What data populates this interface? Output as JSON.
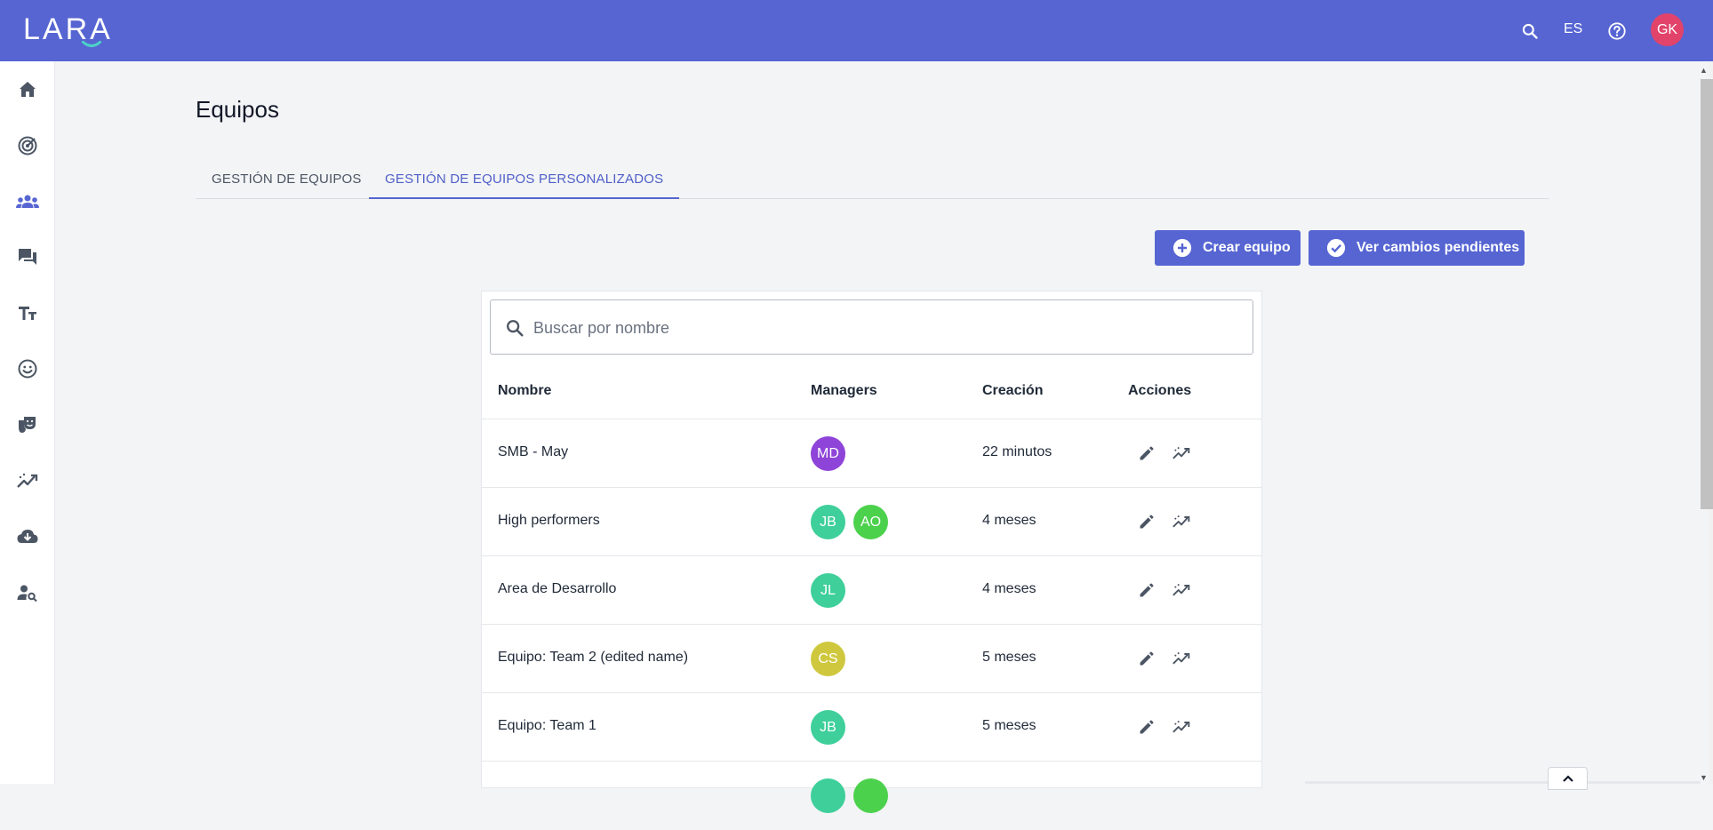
{
  "header": {
    "logo": "LARA",
    "language": "ES",
    "user_initials": "GK",
    "icons": [
      "search-icon",
      "help-icon"
    ],
    "colors": {
      "bar": "#5665d2",
      "avatar": "#e2436a"
    }
  },
  "sidebar": {
    "items": [
      {
        "name": "home",
        "icon": "home-icon"
      },
      {
        "name": "target",
        "icon": "radar-icon"
      },
      {
        "name": "teams",
        "icon": "group-icon",
        "active": true
      },
      {
        "name": "chat",
        "icon": "chat-icon"
      },
      {
        "name": "text",
        "icon": "text-size-icon"
      },
      {
        "name": "mood",
        "icon": "smiley-icon"
      },
      {
        "name": "theater",
        "icon": "masks-icon"
      },
      {
        "name": "analytics",
        "icon": "trend-icon"
      },
      {
        "name": "download",
        "icon": "cloud-download-icon"
      },
      {
        "name": "user-search",
        "icon": "user-search-icon"
      }
    ]
  },
  "page": {
    "title": "Equipos",
    "tabs": [
      {
        "label": "GESTIÓN DE EQUIPOS",
        "active": false
      },
      {
        "label": "GESTIÓN DE EQUIPOS PERSONALIZADOS",
        "active": true
      }
    ],
    "buttons": {
      "create": "Crear equipo",
      "pending": "Ver cambios pendientes"
    }
  },
  "search": {
    "placeholder": "Buscar por nombre",
    "value": ""
  },
  "table": {
    "columns": [
      "Nombre",
      "Managers",
      "Creación",
      "Acciones"
    ],
    "rows": [
      {
        "name": "SMB - May",
        "managers": [
          {
            "initials": "MD",
            "color": "#8e44d8"
          }
        ],
        "created": "22 minutos"
      },
      {
        "name": "High performers",
        "managers": [
          {
            "initials": "JB",
            "color": "#3ecf9a"
          },
          {
            "initials": "AO",
            "color": "#4cd14c"
          }
        ],
        "created": "4 meses"
      },
      {
        "name": "Area de Desarrollo",
        "managers": [
          {
            "initials": "JL",
            "color": "#3ecf9a"
          }
        ],
        "created": "4 meses"
      },
      {
        "name": "Equipo: Team 2 (edited name)",
        "managers": [
          {
            "initials": "CS",
            "color": "#cfc83e"
          }
        ],
        "created": "5 meses"
      },
      {
        "name": "Equipo: Team 1",
        "managers": [
          {
            "initials": "JB",
            "color": "#3ecf9a"
          }
        ],
        "created": "5 meses"
      }
    ],
    "action_icons": [
      "edit-icon",
      "analytics-icon"
    ]
  }
}
